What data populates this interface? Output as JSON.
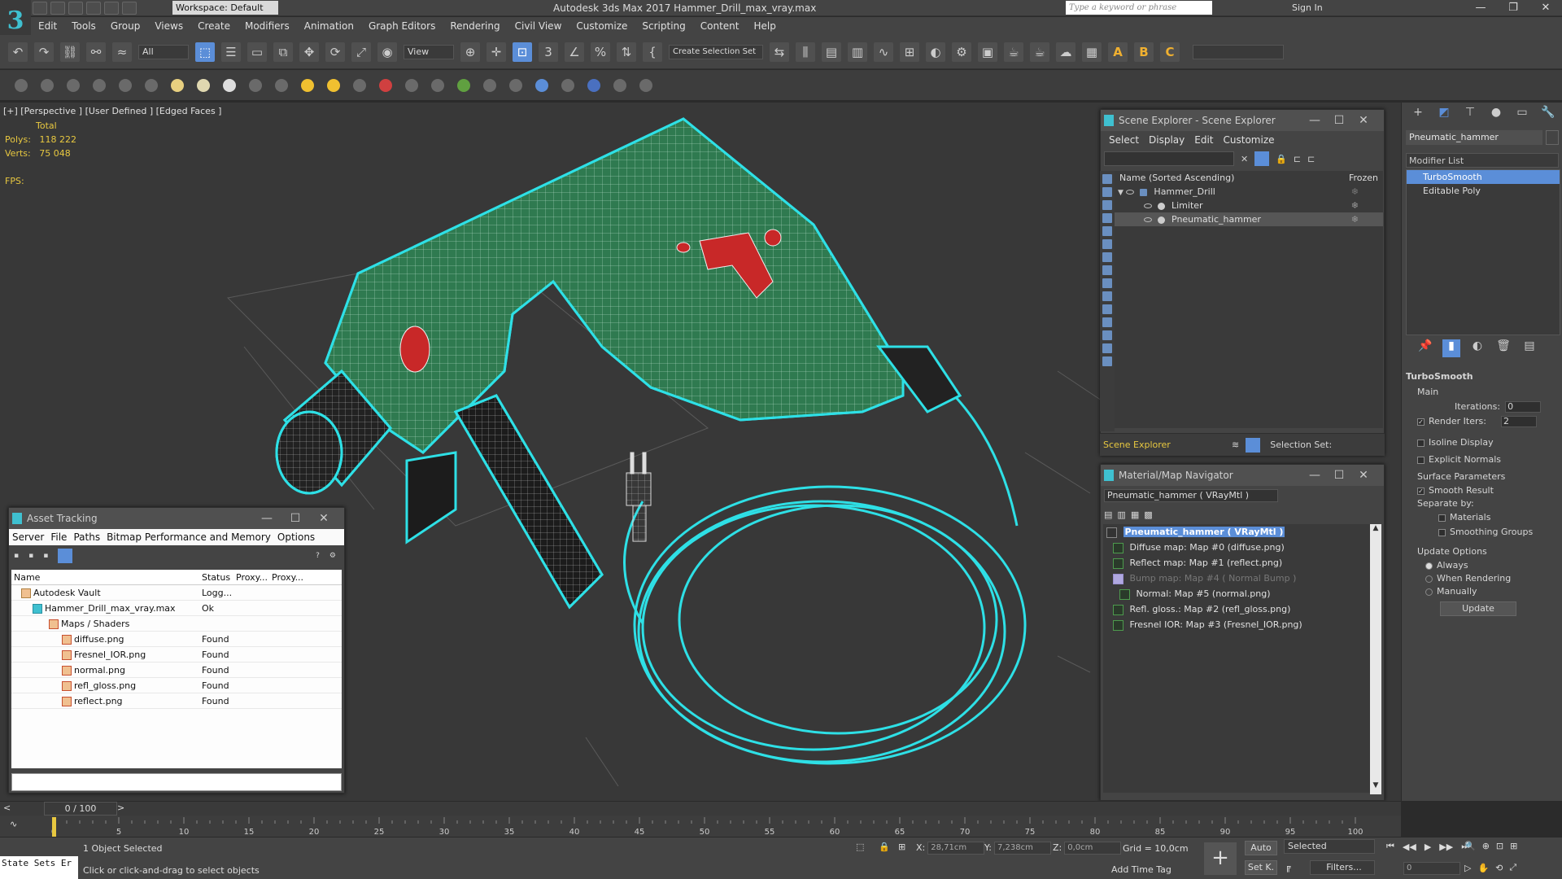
{
  "app": {
    "window_title": "Autodesk 3ds Max 2017     Hammer_Drill_max_vray.max",
    "workspace": "Workspace: Default",
    "search_placeholder": "Type a keyword or phrase",
    "sign_in": "Sign In",
    "logo": "3"
  },
  "menu": [
    "Edit",
    "Tools",
    "Group",
    "Views",
    "Create",
    "Modifiers",
    "Animation",
    "Graph Editors",
    "Rendering",
    "Civil View",
    "Customize",
    "Scripting",
    "Content",
    "Help"
  ],
  "toolbar": {
    "filter": "All",
    "view": "View",
    "selection_set": "Create Selection Set"
  },
  "viewport": {
    "label": "[+] [Perspective ] [User Defined ] [Edged Faces ]",
    "stats_header": "Total",
    "polys_label": "Polys:",
    "polys": "118 222",
    "verts_label": "Verts:",
    "verts": "75 048",
    "fps_label": "FPS:"
  },
  "command_panel": {
    "object_name": "Pneumatic_hammer",
    "modifier_list": "Modifier List",
    "modifiers": [
      "TurboSmooth",
      "Editable Poly"
    ],
    "turbosmooth": {
      "title": "TurboSmooth",
      "main": "Main",
      "iterations_label": "Iterations:",
      "iterations": "0",
      "render_iters_label": "Render Iters:",
      "render_iters": "2",
      "isoline": "Isoline Display",
      "explicit_normals": "Explicit Normals",
      "surface_params": "Surface Parameters",
      "smooth_result": "Smooth Result",
      "separate_by": "Separate by:",
      "materials": "Materials",
      "smoothing_groups": "Smoothing Groups",
      "update_options": "Update Options",
      "always": "Always",
      "when_rendering": "When Rendering",
      "manually": "Manually",
      "update": "Update"
    }
  },
  "scene_explorer": {
    "title": "Scene Explorer - Scene Explorer",
    "menu": [
      "Select",
      "Display",
      "Edit",
      "Customize"
    ],
    "col_name": "Name (Sorted Ascending)",
    "col_frozen": "Frozen",
    "rows": [
      {
        "name": "Hammer_Drill",
        "indent": 1
      },
      {
        "name": "Limiter",
        "indent": 2
      },
      {
        "name": "Pneumatic_hammer",
        "indent": 2
      }
    ],
    "footer_label": "Scene Explorer",
    "selection_set": "Selection Set:"
  },
  "material_navigator": {
    "title": "Material/Map Navigator",
    "current": "Pneumatic_hammer  ( VRayMtl )",
    "items": [
      "Pneumatic_hammer  ( VRayMtl )",
      "Diffuse map: Map #0 (diffuse.png)",
      "Reflect map: Map #1 (reflect.png)",
      "Bump map: Map #4  ( Normal Bump )",
      "Normal: Map #5 (normal.png)",
      "Refl. gloss.: Map #2 (refl_gloss.png)",
      "Fresnel IOR: Map #3 (Fresnel_IOR.png)"
    ]
  },
  "asset_tracking": {
    "title": "Asset Tracking",
    "menu": [
      "Server",
      "File",
      "Paths",
      "Bitmap Performance and Memory",
      "Options"
    ],
    "columns": [
      "Name",
      "Status",
      "Proxy...",
      "Proxy..."
    ],
    "rows": [
      {
        "name": "Autodesk Vault",
        "status": "Logg..."
      },
      {
        "name": "Hammer_Drill_max_vray.max",
        "status": "Ok"
      },
      {
        "name": "Maps / Shaders",
        "status": ""
      },
      {
        "name": "diffuse.png",
        "status": "Found"
      },
      {
        "name": "Fresnel_IOR.png",
        "status": "Found"
      },
      {
        "name": "normal.png",
        "status": "Found"
      },
      {
        "name": "refl_gloss.png",
        "status": "Found"
      },
      {
        "name": "reflect.png",
        "status": "Found"
      }
    ]
  },
  "timeline": {
    "frame": "0 / 100",
    "ticks": [
      "0",
      "5",
      "10",
      "15",
      "20",
      "25",
      "30",
      "35",
      "40",
      "45",
      "50",
      "55",
      "60",
      "65",
      "70",
      "75",
      "80",
      "85",
      "90",
      "95",
      "100"
    ]
  },
  "status": {
    "maxscript": "State Sets Er",
    "selected": "1 Object Selected",
    "prompt": "Click or click-and-drag to select objects",
    "x_label": "X:",
    "x": "28,71cm",
    "y_label": "Y:",
    "y": "7,238cm",
    "z_label": "Z:",
    "z": "0,0cm",
    "grid": "Grid = 10,0cm",
    "auto": "Auto",
    "set_key": "Set K.",
    "selected_dd": "Selected",
    "filters": "Filters...",
    "add_time_tag": "Add Time Tag",
    "frame_field": "0"
  },
  "colors": {
    "accent": "#5b8ed8",
    "drill_green": "#2f7a50",
    "cable_cyan": "#2ee0e6",
    "stats_yellow": "#e8c840"
  }
}
